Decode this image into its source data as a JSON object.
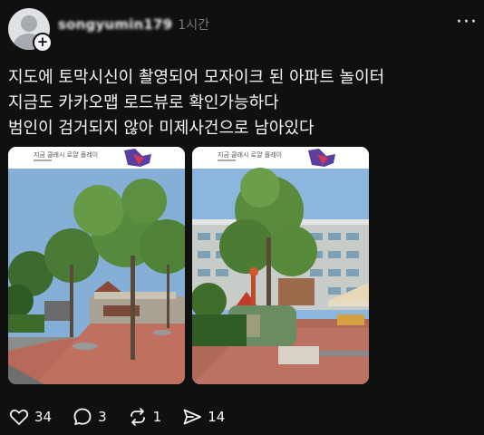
{
  "post": {
    "username": "songyumin179",
    "time": "1시간",
    "text_lines": [
      "지도에 토막시신이 촬영되어 모자이크 된 아파트 놀이터",
      "지금도 카카오맵 로드뷰로 확인가능하다",
      "범인이 검거되지 않아 미제사건으로 남아있다"
    ],
    "more_icon": "ellipsis-icon",
    "avatar_icon": "default-avatar-icon",
    "follow_icon": "plus-icon",
    "images": [
      {
        "caption": "지금 클래시 로얄 플레이",
        "description": "playground-roadview-photo"
      },
      {
        "caption": "지금 클래시 로얄 플레이",
        "description": "apartment-playground-blurred-photo"
      }
    ]
  },
  "actions": {
    "like_count": "34",
    "reply_count": "3",
    "repost_count": "1",
    "share_count": "14"
  }
}
